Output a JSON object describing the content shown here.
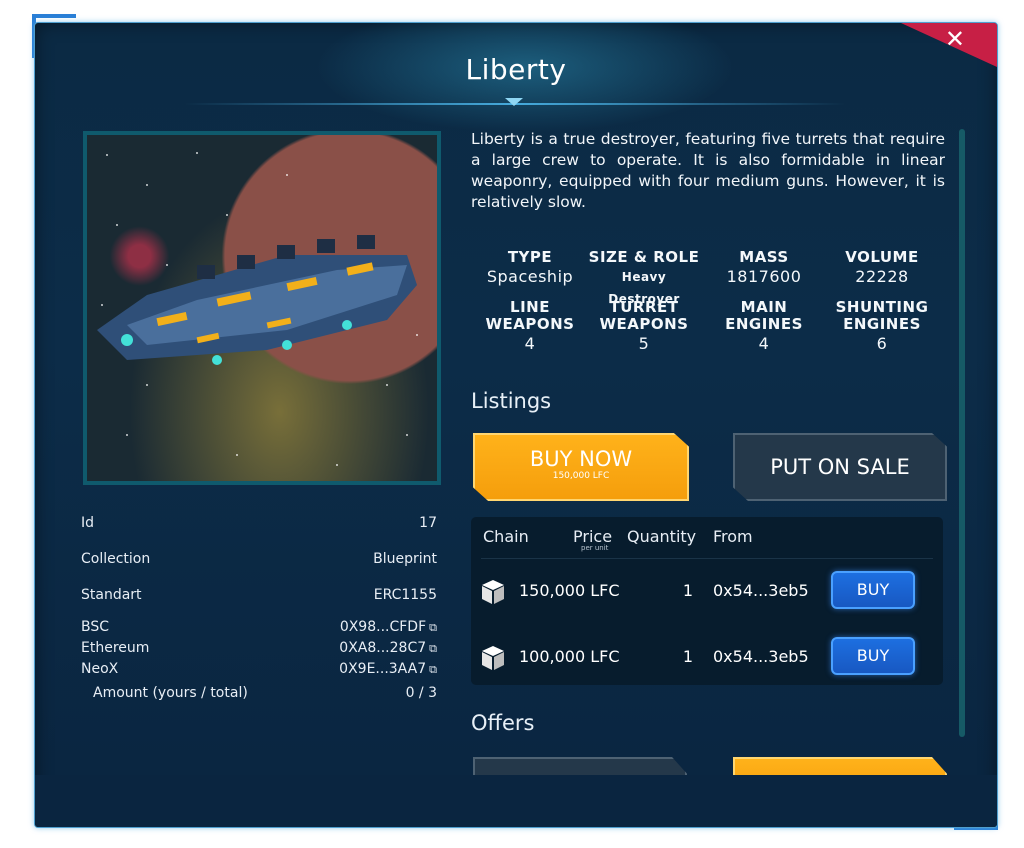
{
  "dialog": {
    "title": "Liberty",
    "close_label": "✕"
  },
  "description": "Liberty is a true destroyer, featuring five turrets that require a large crew to operate. It is also formidable in linear weaponry, equipped with four medium guns. However, it is relatively slow.",
  "stats": [
    {
      "label": "TYPE",
      "value": "Spaceship"
    },
    {
      "label": "SIZE & ROLE",
      "value": "Heavy Destroyer"
    },
    {
      "label": "MASS",
      "value": "1817600"
    },
    {
      "label": "VOLUME",
      "value": "22228"
    },
    {
      "label": "LINE\nWEAPONS",
      "value": "4"
    },
    {
      "label": "TURRET\nWEAPONS",
      "value": "5"
    },
    {
      "label": "MAIN\nENGINES",
      "value": "4"
    },
    {
      "label": "SHUNTING\nENGINES",
      "value": "6"
    }
  ],
  "properties": [
    {
      "key": "Id",
      "value": "17"
    },
    {
      "key": "Collection",
      "value": "Blueprint"
    },
    {
      "key": "Standart",
      "value": "ERC1155"
    },
    {
      "key": "BSC",
      "value": "0X98...CFDF"
    },
    {
      "key": "Ethereum",
      "value": "0XA8...28C7"
    },
    {
      "key": "NeoX",
      "value": "0X9E...3AA7"
    },
    {
      "key": "Amount (yours / total)",
      "value": "0 / 3"
    }
  ],
  "link_icon": "external-link-icon",
  "listings": {
    "heading": "Listings",
    "buy_now_label": "BUY NOW",
    "buy_now_price": "150,000 LFC",
    "put_on_sale_label": "PUT ON SALE",
    "columns": {
      "chain": "Chain",
      "price": "Price",
      "price_sub": "per unit",
      "quantity": "Quantity",
      "from": "From"
    },
    "rows": [
      {
        "price": "150,000 LFC",
        "quantity": "1",
        "from": "0x54...3eb5",
        "action": "BUY"
      },
      {
        "price": "100,000 LFC",
        "quantity": "1",
        "from": "0x54...3eb5",
        "action": "BUY"
      }
    ]
  },
  "offers": {
    "heading": "Offers"
  },
  "colors": {
    "accent_orange": "#f59e0c",
    "buy_blue": "#1858c2",
    "close_red": "#c71f45",
    "panel_bg": "#0b2a44"
  }
}
